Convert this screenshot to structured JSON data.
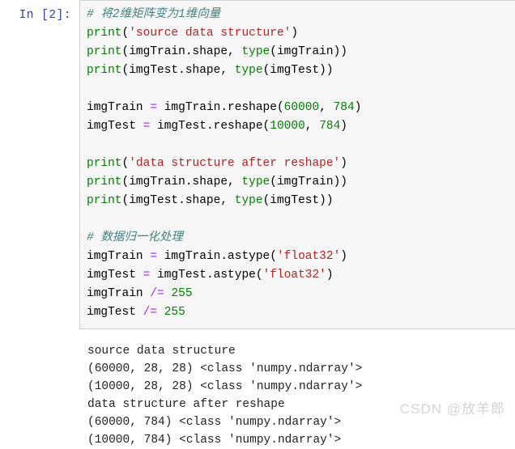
{
  "notebook": {
    "input_prompt": "In [2]:",
    "colors": {
      "prompt": "#303f9f",
      "cell_background": "#f7f7f7",
      "cell_border": "#cfcfcf",
      "comment": "#408080",
      "builtin": "#008000",
      "string": "#ba2121",
      "number": "#008000",
      "operator": "#aa22ff",
      "output_text": "#222222",
      "watermark": "#d4d4d4"
    },
    "code_lines": [
      [
        {
          "t": "# 将2维矩阵变为1维向量",
          "c": "tok-comment"
        }
      ],
      [
        {
          "t": "print",
          "c": "tok-builtin"
        },
        {
          "t": "(",
          "c": "tok-plain"
        },
        {
          "t": "'source data structure'",
          "c": "tok-string"
        },
        {
          "t": ")",
          "c": "tok-plain"
        }
      ],
      [
        {
          "t": "print",
          "c": "tok-builtin"
        },
        {
          "t": "(imgTrain.shape, ",
          "c": "tok-plain"
        },
        {
          "t": "type",
          "c": "tok-builtin"
        },
        {
          "t": "(imgTrain))",
          "c": "tok-plain"
        }
      ],
      [
        {
          "t": "print",
          "c": "tok-builtin"
        },
        {
          "t": "(imgTest.shape, ",
          "c": "tok-plain"
        },
        {
          "t": "type",
          "c": "tok-builtin"
        },
        {
          "t": "(imgTest))",
          "c": "tok-plain"
        }
      ],
      [
        {
          "t": " ",
          "c": "tok-plain"
        }
      ],
      [
        {
          "t": "imgTrain ",
          "c": "tok-plain"
        },
        {
          "t": "=",
          "c": "tok-op"
        },
        {
          "t": " imgTrain.reshape(",
          "c": "tok-plain"
        },
        {
          "t": "60000",
          "c": "tok-number"
        },
        {
          "t": ", ",
          "c": "tok-plain"
        },
        {
          "t": "784",
          "c": "tok-number"
        },
        {
          "t": ")",
          "c": "tok-plain"
        }
      ],
      [
        {
          "t": "imgTest ",
          "c": "tok-plain"
        },
        {
          "t": "=",
          "c": "tok-op"
        },
        {
          "t": " imgTest.reshape(",
          "c": "tok-plain"
        },
        {
          "t": "10000",
          "c": "tok-number"
        },
        {
          "t": ", ",
          "c": "tok-plain"
        },
        {
          "t": "784",
          "c": "tok-number"
        },
        {
          "t": ")",
          "c": "tok-plain"
        }
      ],
      [
        {
          "t": " ",
          "c": "tok-plain"
        }
      ],
      [
        {
          "t": "print",
          "c": "tok-builtin"
        },
        {
          "t": "(",
          "c": "tok-plain"
        },
        {
          "t": "'data structure after reshape'",
          "c": "tok-string"
        },
        {
          "t": ")",
          "c": "tok-plain"
        }
      ],
      [
        {
          "t": "print",
          "c": "tok-builtin"
        },
        {
          "t": "(imgTrain.shape, ",
          "c": "tok-plain"
        },
        {
          "t": "type",
          "c": "tok-builtin"
        },
        {
          "t": "(imgTrain))",
          "c": "tok-plain"
        }
      ],
      [
        {
          "t": "print",
          "c": "tok-builtin"
        },
        {
          "t": "(imgTest.shape, ",
          "c": "tok-plain"
        },
        {
          "t": "type",
          "c": "tok-builtin"
        },
        {
          "t": "(imgTest))",
          "c": "tok-plain"
        }
      ],
      [
        {
          "t": " ",
          "c": "tok-plain"
        }
      ],
      [
        {
          "t": "# 数据归一化处理",
          "c": "tok-comment"
        }
      ],
      [
        {
          "t": "imgTrain ",
          "c": "tok-plain"
        },
        {
          "t": "=",
          "c": "tok-op"
        },
        {
          "t": " imgTrain.astype(",
          "c": "tok-plain"
        },
        {
          "t": "'float32'",
          "c": "tok-string"
        },
        {
          "t": ")",
          "c": "tok-plain"
        }
      ],
      [
        {
          "t": "imgTest ",
          "c": "tok-plain"
        },
        {
          "t": "=",
          "c": "tok-op"
        },
        {
          "t": " imgTest.astype(",
          "c": "tok-plain"
        },
        {
          "t": "'float32'",
          "c": "tok-string"
        },
        {
          "t": ")",
          "c": "tok-plain"
        }
      ],
      [
        {
          "t": "imgTrain ",
          "c": "tok-plain"
        },
        {
          "t": "/=",
          "c": "tok-op"
        },
        {
          "t": " ",
          "c": "tok-plain"
        },
        {
          "t": "255",
          "c": "tok-number"
        }
      ],
      [
        {
          "t": "imgTest ",
          "c": "tok-plain"
        },
        {
          "t": "/=",
          "c": "tok-op"
        },
        {
          "t": " ",
          "c": "tok-plain"
        },
        {
          "t": "255",
          "c": "tok-number"
        }
      ]
    ],
    "output_lines": [
      "source data structure",
      "(60000, 28, 28) <class 'numpy.ndarray'>",
      "(10000, 28, 28) <class 'numpy.ndarray'>",
      "data structure after reshape",
      "(60000, 784) <class 'numpy.ndarray'>",
      "(10000, 784) <class 'numpy.ndarray'>"
    ]
  },
  "watermark": {
    "text": "CSDN @放羊郎"
  }
}
